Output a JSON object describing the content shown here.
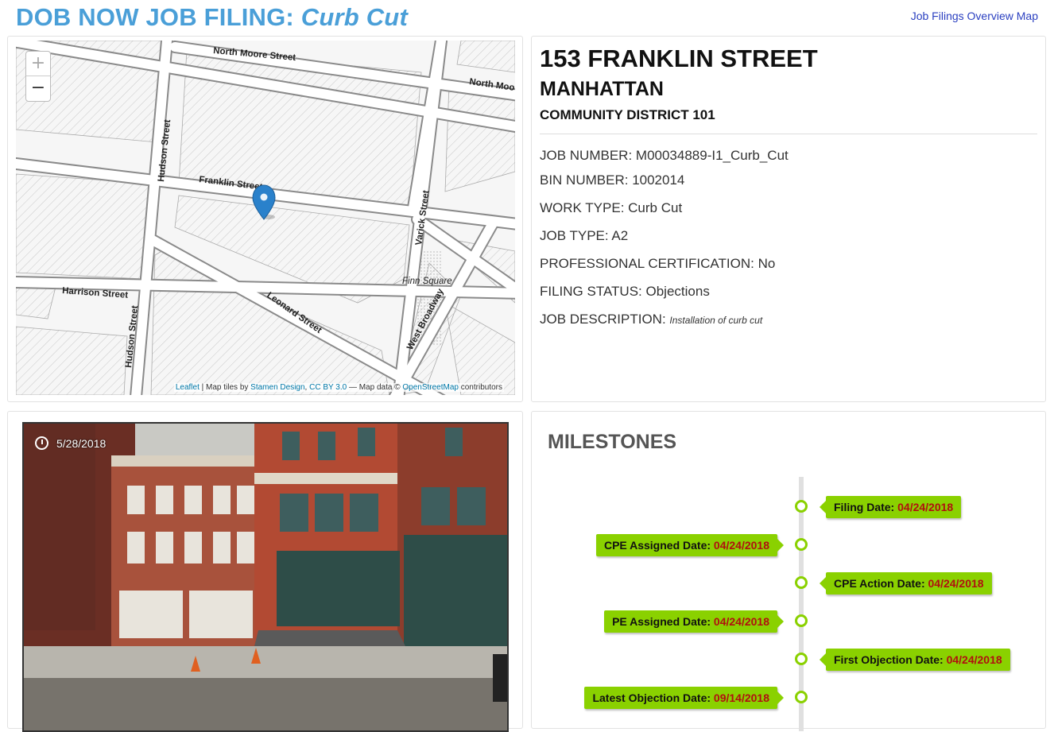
{
  "header": {
    "title_prefix": "DOB NOW JOB FILING:",
    "title_type": "Curb Cut",
    "overview_link": "Job Filings Overview Map"
  },
  "map": {
    "zoom_in": "+",
    "zoom_out": "−",
    "streets": {
      "north_moore": "North Moore Street",
      "north_moore_2": "North Moo",
      "hudson_top": "Hudson Street",
      "hudson_bottom": "Hudson Street",
      "franklin": "Franklin Street",
      "varick": "Varick Street",
      "harrison": "Harrison Street",
      "leonard": "Leonard Street",
      "finn": "Finn Square",
      "west_broadway": "West Broadway"
    },
    "attribution": {
      "leaflet": "Leaflet",
      "sep": " | Map tiles by ",
      "stamen": "Stamen Design",
      "comma": ", ",
      "license": "CC BY 3.0",
      "dash": " — Map data © ",
      "osm": "OpenStreetMap",
      "contrib": " contributors"
    }
  },
  "info": {
    "address": "153 FRANKLIN STREET",
    "borough": "MANHATTAN",
    "community_district": "COMMUNITY DISTRICT 101",
    "fields": [
      {
        "label": "JOB NUMBER: ",
        "value": "M00034889-I1_Curb_Cut"
      },
      {
        "label": "BIN NUMBER: ",
        "value": "1002014"
      },
      {
        "label": "WORK TYPE: ",
        "value": "Curb Cut"
      },
      {
        "label": "JOB TYPE: ",
        "value": "A2"
      },
      {
        "label": "PROFESSIONAL CERTIFICATION: ",
        "value": "No"
      },
      {
        "label": "FILING STATUS: ",
        "value": "Objections"
      },
      {
        "label": "JOB DESCRIPTION: ",
        "value": "Installation of curb cut"
      }
    ]
  },
  "photo": {
    "date": "5/28/2018"
  },
  "milestones": {
    "title": "MILESTONES",
    "items": [
      {
        "label": "Filing Date: ",
        "date": "04/24/2018",
        "side": "right"
      },
      {
        "label": "CPE Assigned Date: ",
        "date": "04/24/2018",
        "side": "left"
      },
      {
        "label": "CPE Action Date: ",
        "date": "04/24/2018",
        "side": "right"
      },
      {
        "label": "PE Assigned Date: ",
        "date": "04/24/2018",
        "side": "left"
      },
      {
        "label": "First Objection Date: ",
        "date": "04/24/2018",
        "side": "right"
      },
      {
        "label": "Latest Objection Date: ",
        "date": "09/14/2018",
        "side": "left"
      }
    ]
  },
  "colors": {
    "title_blue": "#4a9fd8",
    "link_blue": "#2a3fc0",
    "milestone_green": "#8ad100",
    "milestone_date_red": "#b01010",
    "marker_blue": "#2a81cb"
  }
}
